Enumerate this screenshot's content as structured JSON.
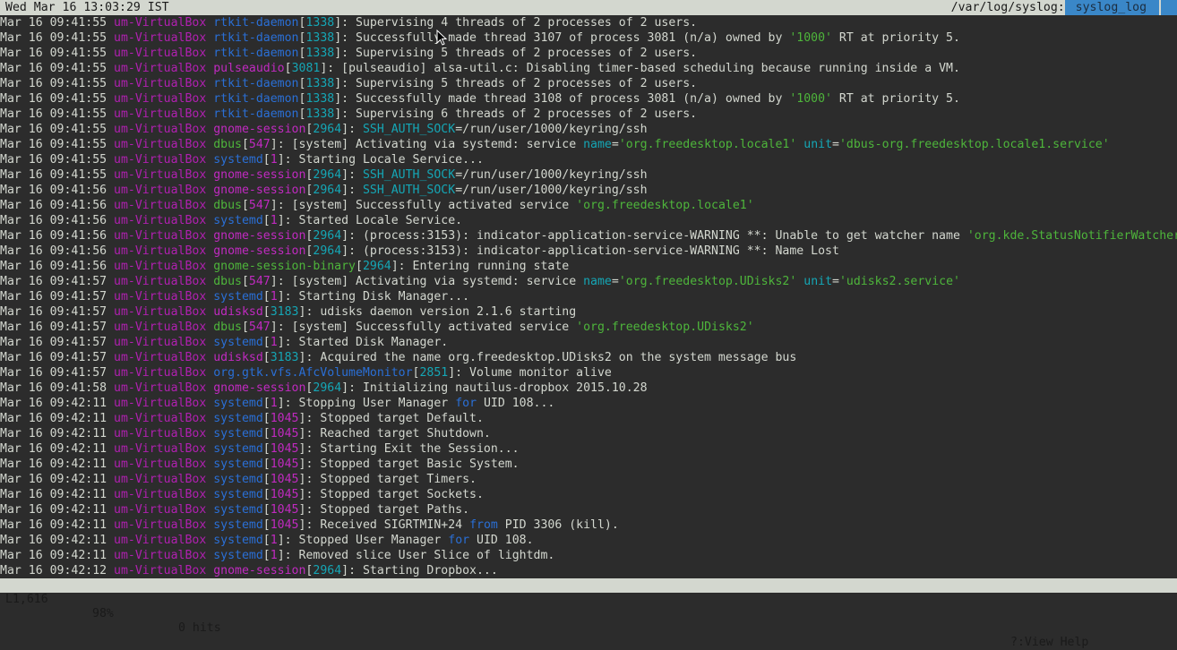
{
  "topbar": {
    "clock": "Wed Mar 16 13:03:29 IST",
    "path": "/var/log/syslog:",
    "tab_label": " syslog_log "
  },
  "log_lines": [
    [
      [
        "ts",
        "Mar 16 09:41:55 "
      ],
      [
        "host",
        "um-VirtualBox "
      ],
      [
        "proc-blue",
        "rtkit-daemon"
      ],
      [
        "ts",
        "["
      ],
      [
        "pid-cyan",
        "1338"
      ],
      [
        "ts",
        "]: Supervising 4 threads of 2 processes of 2 users."
      ]
    ],
    [
      [
        "ts",
        "Mar 16 09:41:55 "
      ],
      [
        "host",
        "um-VirtualBox "
      ],
      [
        "proc-blue",
        "rtkit-daemon"
      ],
      [
        "ts",
        "["
      ],
      [
        "pid-cyan",
        "1338"
      ],
      [
        "ts",
        "]: Successfully made thread 3107 of process 3081 (n/a) owned by "
      ],
      [
        "q",
        "'1000'"
      ],
      [
        "ts",
        " RT at priority 5."
      ]
    ],
    [
      [
        "ts",
        "Mar 16 09:41:55 "
      ],
      [
        "host",
        "um-VirtualBox "
      ],
      [
        "proc-blue",
        "rtkit-daemon"
      ],
      [
        "ts",
        "["
      ],
      [
        "pid-cyan",
        "1338"
      ],
      [
        "ts",
        "]: Supervising 5 threads of 2 processes of 2 users."
      ]
    ],
    [
      [
        "ts",
        "Mar 16 09:41:55 "
      ],
      [
        "host",
        "um-VirtualBox "
      ],
      [
        "proc-mag",
        "pulseaudio"
      ],
      [
        "ts",
        "["
      ],
      [
        "pid-cyan",
        "3081"
      ],
      [
        "ts",
        "]: [pulseaudio] alsa-util.c: Disabling timer-based scheduling because running inside a VM."
      ]
    ],
    [
      [
        "ts",
        "Mar 16 09:41:55 "
      ],
      [
        "host",
        "um-VirtualBox "
      ],
      [
        "proc-blue",
        "rtkit-daemon"
      ],
      [
        "ts",
        "["
      ],
      [
        "pid-cyan",
        "1338"
      ],
      [
        "ts",
        "]: Supervising 5 threads of 2 processes of 2 users."
      ]
    ],
    [
      [
        "ts",
        "Mar 16 09:41:55 "
      ],
      [
        "host",
        "um-VirtualBox "
      ],
      [
        "proc-blue",
        "rtkit-daemon"
      ],
      [
        "ts",
        "["
      ],
      [
        "pid-cyan",
        "1338"
      ],
      [
        "ts",
        "]: Successfully made thread 3108 of process 3081 (n/a) owned by "
      ],
      [
        "q",
        "'1000'"
      ],
      [
        "ts",
        " RT at priority 5."
      ]
    ],
    [
      [
        "ts",
        "Mar 16 09:41:55 "
      ],
      [
        "host",
        "um-VirtualBox "
      ],
      [
        "proc-blue",
        "rtkit-daemon"
      ],
      [
        "ts",
        "["
      ],
      [
        "pid-cyan",
        "1338"
      ],
      [
        "ts",
        "]: Supervising 6 threads of 2 processes of 2 users."
      ]
    ],
    [
      [
        "ts",
        "Mar 16 09:41:55 "
      ],
      [
        "host",
        "um-VirtualBox "
      ],
      [
        "proc-mag",
        "gnome-session"
      ],
      [
        "ts",
        "["
      ],
      [
        "pid-cyan",
        "2964"
      ],
      [
        "ts",
        "]: "
      ],
      [
        "cyan",
        "SSH_AUTH_SOCK"
      ],
      [
        "ts",
        "=/run/user/1000/keyring/ssh"
      ]
    ],
    [
      [
        "ts",
        "Mar 16 09:41:55 "
      ],
      [
        "host",
        "um-VirtualBox "
      ],
      [
        "proc-green",
        "dbus"
      ],
      [
        "ts",
        "["
      ],
      [
        "pid-mag",
        "547"
      ],
      [
        "ts",
        "]: [system] Activating via systemd: service "
      ],
      [
        "cyan",
        "name"
      ],
      [
        "ts",
        "="
      ],
      [
        "q",
        "'org.freedesktop.locale1'"
      ],
      [
        "ts",
        " "
      ],
      [
        "cyan",
        "unit"
      ],
      [
        "ts",
        "="
      ],
      [
        "q",
        "'dbus-org.freedesktop.locale1.service'"
      ]
    ],
    [
      [
        "ts",
        "Mar 16 09:41:55 "
      ],
      [
        "host",
        "um-VirtualBox "
      ],
      [
        "proc-blue",
        "systemd"
      ],
      [
        "ts",
        "["
      ],
      [
        "pid-mag",
        "1"
      ],
      [
        "ts",
        "]: Starting Locale Service..."
      ]
    ],
    [
      [
        "ts",
        "Mar 16 09:41:55 "
      ],
      [
        "host",
        "um-VirtualBox "
      ],
      [
        "proc-mag",
        "gnome-session"
      ],
      [
        "ts",
        "["
      ],
      [
        "pid-cyan",
        "2964"
      ],
      [
        "ts",
        "]: "
      ],
      [
        "cyan",
        "SSH_AUTH_SOCK"
      ],
      [
        "ts",
        "=/run/user/1000/keyring/ssh"
      ]
    ],
    [
      [
        "ts",
        "Mar 16 09:41:56 "
      ],
      [
        "host",
        "um-VirtualBox "
      ],
      [
        "proc-mag",
        "gnome-session"
      ],
      [
        "ts",
        "["
      ],
      [
        "pid-cyan",
        "2964"
      ],
      [
        "ts",
        "]: "
      ],
      [
        "cyan",
        "SSH_AUTH_SOCK"
      ],
      [
        "ts",
        "=/run/user/1000/keyring/ssh"
      ]
    ],
    [
      [
        "ts",
        "Mar 16 09:41:56 "
      ],
      [
        "host",
        "um-VirtualBox "
      ],
      [
        "proc-green",
        "dbus"
      ],
      [
        "ts",
        "["
      ],
      [
        "pid-mag",
        "547"
      ],
      [
        "ts",
        "]: [system] Successfully activated service "
      ],
      [
        "q",
        "'org.freedesktop.locale1'"
      ]
    ],
    [
      [
        "ts",
        "Mar 16 09:41:56 "
      ],
      [
        "host",
        "um-VirtualBox "
      ],
      [
        "proc-blue",
        "systemd"
      ],
      [
        "ts",
        "["
      ],
      [
        "pid-mag",
        "1"
      ],
      [
        "ts",
        "]: Started Locale Service."
      ]
    ],
    [
      [
        "ts",
        "Mar 16 09:41:56 "
      ],
      [
        "host",
        "um-VirtualBox "
      ],
      [
        "proc-mag",
        "gnome-session"
      ],
      [
        "ts",
        "["
      ],
      [
        "pid-cyan",
        "2964"
      ],
      [
        "ts",
        "]: (process:3153): indicator-application-service-WARNING **: Unable to get watcher name "
      ],
      [
        "q",
        "'org.kde.StatusNotifierWatcher'"
      ]
    ],
    [
      [
        "ts",
        "Mar 16 09:41:56 "
      ],
      [
        "host",
        "um-VirtualBox "
      ],
      [
        "proc-mag",
        "gnome-session"
      ],
      [
        "ts",
        "["
      ],
      [
        "pid-cyan",
        "2964"
      ],
      [
        "ts",
        "]: (process:3153): indicator-application-service-WARNING **: Name Lost"
      ]
    ],
    [
      [
        "ts",
        "Mar 16 09:41:56 "
      ],
      [
        "host",
        "um-VirtualBox "
      ],
      [
        "proc-green",
        "gnome-session-binary"
      ],
      [
        "ts",
        "["
      ],
      [
        "pid-cyan",
        "2964"
      ],
      [
        "ts",
        "]: Entering running state"
      ]
    ],
    [
      [
        "ts",
        "Mar 16 09:41:57 "
      ],
      [
        "host",
        "um-VirtualBox "
      ],
      [
        "proc-green",
        "dbus"
      ],
      [
        "ts",
        "["
      ],
      [
        "pid-mag",
        "547"
      ],
      [
        "ts",
        "]: [system] Activating via systemd: service "
      ],
      [
        "cyan",
        "name"
      ],
      [
        "ts",
        "="
      ],
      [
        "q",
        "'org.freedesktop.UDisks2'"
      ],
      [
        "ts",
        " "
      ],
      [
        "cyan",
        "unit"
      ],
      [
        "ts",
        "="
      ],
      [
        "q",
        "'udisks2.service'"
      ]
    ],
    [
      [
        "ts",
        "Mar 16 09:41:57 "
      ],
      [
        "host",
        "um-VirtualBox "
      ],
      [
        "proc-blue",
        "systemd"
      ],
      [
        "ts",
        "["
      ],
      [
        "pid-mag",
        "1"
      ],
      [
        "ts",
        "]: Starting Disk Manager..."
      ]
    ],
    [
      [
        "ts",
        "Mar 16 09:41:57 "
      ],
      [
        "host",
        "um-VirtualBox "
      ],
      [
        "proc-mag",
        "udisksd"
      ],
      [
        "ts",
        "["
      ],
      [
        "pid-cyan",
        "3183"
      ],
      [
        "ts",
        "]: udisks daemon version 2.1.6 starting"
      ]
    ],
    [
      [
        "ts",
        "Mar 16 09:41:57 "
      ],
      [
        "host",
        "um-VirtualBox "
      ],
      [
        "proc-green",
        "dbus"
      ],
      [
        "ts",
        "["
      ],
      [
        "pid-mag",
        "547"
      ],
      [
        "ts",
        "]: [system] Successfully activated service "
      ],
      [
        "q",
        "'org.freedesktop.UDisks2'"
      ]
    ],
    [
      [
        "ts",
        "Mar 16 09:41:57 "
      ],
      [
        "host",
        "um-VirtualBox "
      ],
      [
        "proc-blue",
        "systemd"
      ],
      [
        "ts",
        "["
      ],
      [
        "pid-mag",
        "1"
      ],
      [
        "ts",
        "]: Started Disk Manager."
      ]
    ],
    [
      [
        "ts",
        "Mar 16 09:41:57 "
      ],
      [
        "host",
        "um-VirtualBox "
      ],
      [
        "proc-mag",
        "udisksd"
      ],
      [
        "ts",
        "["
      ],
      [
        "pid-cyan",
        "3183"
      ],
      [
        "ts",
        "]: Acquired the name org.freedesktop.UDisks2 on the system message bus"
      ]
    ],
    [
      [
        "ts",
        "Mar 16 09:41:57 "
      ],
      [
        "host",
        "um-VirtualBox "
      ],
      [
        "proc-blue",
        "org.gtk.vfs.AfcVolumeMonitor"
      ],
      [
        "ts",
        "["
      ],
      [
        "pid-cyan",
        "2851"
      ],
      [
        "ts",
        "]: Volume monitor alive"
      ]
    ],
    [
      [
        "ts",
        "Mar 16 09:41:58 "
      ],
      [
        "host",
        "um-VirtualBox "
      ],
      [
        "proc-mag",
        "gnome-session"
      ],
      [
        "ts",
        "["
      ],
      [
        "pid-cyan",
        "2964"
      ],
      [
        "ts",
        "]: Initializing nautilus-dropbox 2015.10.28"
      ]
    ],
    [
      [
        "ts",
        "Mar 16 09:42:11 "
      ],
      [
        "host",
        "um-VirtualBox "
      ],
      [
        "proc-blue",
        "systemd"
      ],
      [
        "ts",
        "["
      ],
      [
        "pid-mag",
        "1"
      ],
      [
        "ts",
        "]: Stopping User Manager "
      ],
      [
        "kw",
        "for"
      ],
      [
        "ts",
        " UID 108..."
      ]
    ],
    [
      [
        "ts",
        "Mar 16 09:42:11 "
      ],
      [
        "host",
        "um-VirtualBox "
      ],
      [
        "proc-blue",
        "systemd"
      ],
      [
        "ts",
        "["
      ],
      [
        "pid-mag",
        "1045"
      ],
      [
        "ts",
        "]: Stopped target Default."
      ]
    ],
    [
      [
        "ts",
        "Mar 16 09:42:11 "
      ],
      [
        "host",
        "um-VirtualBox "
      ],
      [
        "proc-blue",
        "systemd"
      ],
      [
        "ts",
        "["
      ],
      [
        "pid-mag",
        "1045"
      ],
      [
        "ts",
        "]: Reached target Shutdown."
      ]
    ],
    [
      [
        "ts",
        "Mar 16 09:42:11 "
      ],
      [
        "host",
        "um-VirtualBox "
      ],
      [
        "proc-blue",
        "systemd"
      ],
      [
        "ts",
        "["
      ],
      [
        "pid-mag",
        "1045"
      ],
      [
        "ts",
        "]: Starting Exit the Session..."
      ]
    ],
    [
      [
        "ts",
        "Mar 16 09:42:11 "
      ],
      [
        "host",
        "um-VirtualBox "
      ],
      [
        "proc-blue",
        "systemd"
      ],
      [
        "ts",
        "["
      ],
      [
        "pid-mag",
        "1045"
      ],
      [
        "ts",
        "]: Stopped target Basic System."
      ]
    ],
    [
      [
        "ts",
        "Mar 16 09:42:11 "
      ],
      [
        "host",
        "um-VirtualBox "
      ],
      [
        "proc-blue",
        "systemd"
      ],
      [
        "ts",
        "["
      ],
      [
        "pid-mag",
        "1045"
      ],
      [
        "ts",
        "]: Stopped target Timers."
      ]
    ],
    [
      [
        "ts",
        "Mar 16 09:42:11 "
      ],
      [
        "host",
        "um-VirtualBox "
      ],
      [
        "proc-blue",
        "systemd"
      ],
      [
        "ts",
        "["
      ],
      [
        "pid-mag",
        "1045"
      ],
      [
        "ts",
        "]: Stopped target Sockets."
      ]
    ],
    [
      [
        "ts",
        "Mar 16 09:42:11 "
      ],
      [
        "host",
        "um-VirtualBox "
      ],
      [
        "proc-blue",
        "systemd"
      ],
      [
        "ts",
        "["
      ],
      [
        "pid-mag",
        "1045"
      ],
      [
        "ts",
        "]: Stopped target Paths."
      ]
    ],
    [
      [
        "ts",
        "Mar 16 09:42:11 "
      ],
      [
        "host",
        "um-VirtualBox "
      ],
      [
        "proc-blue",
        "systemd"
      ],
      [
        "ts",
        "["
      ],
      [
        "pid-mag",
        "1045"
      ],
      [
        "ts",
        "]: Received SIGRTMIN+24 "
      ],
      [
        "kw",
        "from"
      ],
      [
        "ts",
        " PID 3306 (kill)."
      ]
    ],
    [
      [
        "ts",
        "Mar 16 09:42:11 "
      ],
      [
        "host",
        "um-VirtualBox "
      ],
      [
        "proc-blue",
        "systemd"
      ],
      [
        "ts",
        "["
      ],
      [
        "pid-mag",
        "1"
      ],
      [
        "ts",
        "]: Stopped User Manager "
      ],
      [
        "kw",
        "for"
      ],
      [
        "ts",
        " UID 108."
      ]
    ],
    [
      [
        "ts",
        "Mar 16 09:42:11 "
      ],
      [
        "host",
        "um-VirtualBox "
      ],
      [
        "proc-blue",
        "systemd"
      ],
      [
        "ts",
        "["
      ],
      [
        "pid-mag",
        "1"
      ],
      [
        "ts",
        "]: Removed slice User Slice of lightdm."
      ]
    ],
    [
      [
        "ts",
        "Mar 16 09:42:12 "
      ],
      [
        "host",
        "um-VirtualBox "
      ],
      [
        "proc-mag",
        "gnome-session"
      ],
      [
        "ts",
        "["
      ],
      [
        "pid-cyan",
        "2964"
      ],
      [
        "ts",
        "]: Starting Dropbox..."
      ]
    ]
  ],
  "status": {
    "position": "L1,616",
    "percent": "98%",
    "hits": "0 hits",
    "help": "?:View Help"
  },
  "colors": {
    "background": "#2c2c2c",
    "bar": "#d3d7cf",
    "host": "#b020b0",
    "blue": "#2a6fd6",
    "green": "#4eb53b",
    "cyan": "#15a6b5",
    "tab": "#3a87c8"
  },
  "icons": {
    "cursor": "mouse-pointer-icon"
  }
}
